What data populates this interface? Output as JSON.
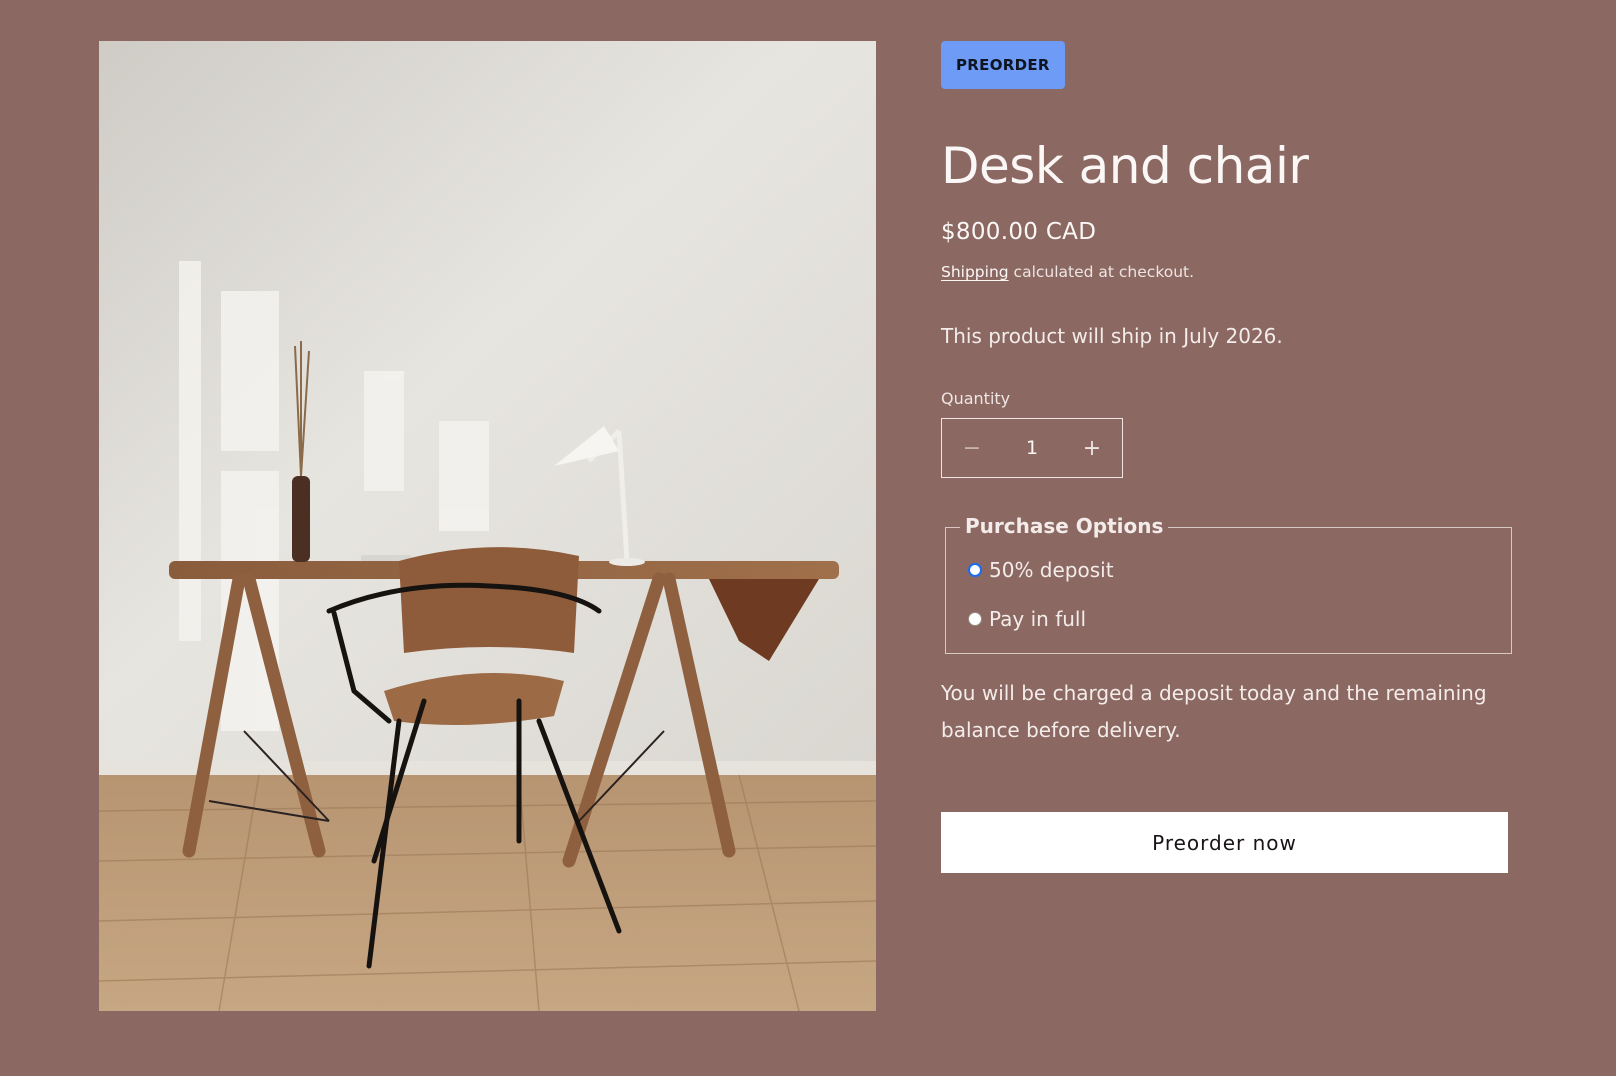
{
  "product": {
    "badge": "PREORDER",
    "title": "Desk and chair",
    "price": "$800.00 CAD",
    "shipping_link": "Shipping",
    "shipping_suffix": " calculated at checkout.",
    "ship_note": "This product will ship in July 2026.",
    "image_alt": "Wooden desk with a wooden chair, white lamp and vase in a sunlit room"
  },
  "quantity": {
    "label": "Quantity",
    "value": "1",
    "decrement_symbol": "−",
    "increment_symbol": "+"
  },
  "purchase_options": {
    "legend": "Purchase Options",
    "options": [
      {
        "label": "50% deposit",
        "selected": true
      },
      {
        "label": "Pay in full",
        "selected": false
      }
    ],
    "note": "You will be charged a deposit today and the remaining balance before delivery."
  },
  "cta": {
    "label": "Preorder now"
  },
  "colors": {
    "background": "#8b6962",
    "badge": "#6e9bf6",
    "button": "#ffffff",
    "radio_selected": "#1a6cf0"
  }
}
